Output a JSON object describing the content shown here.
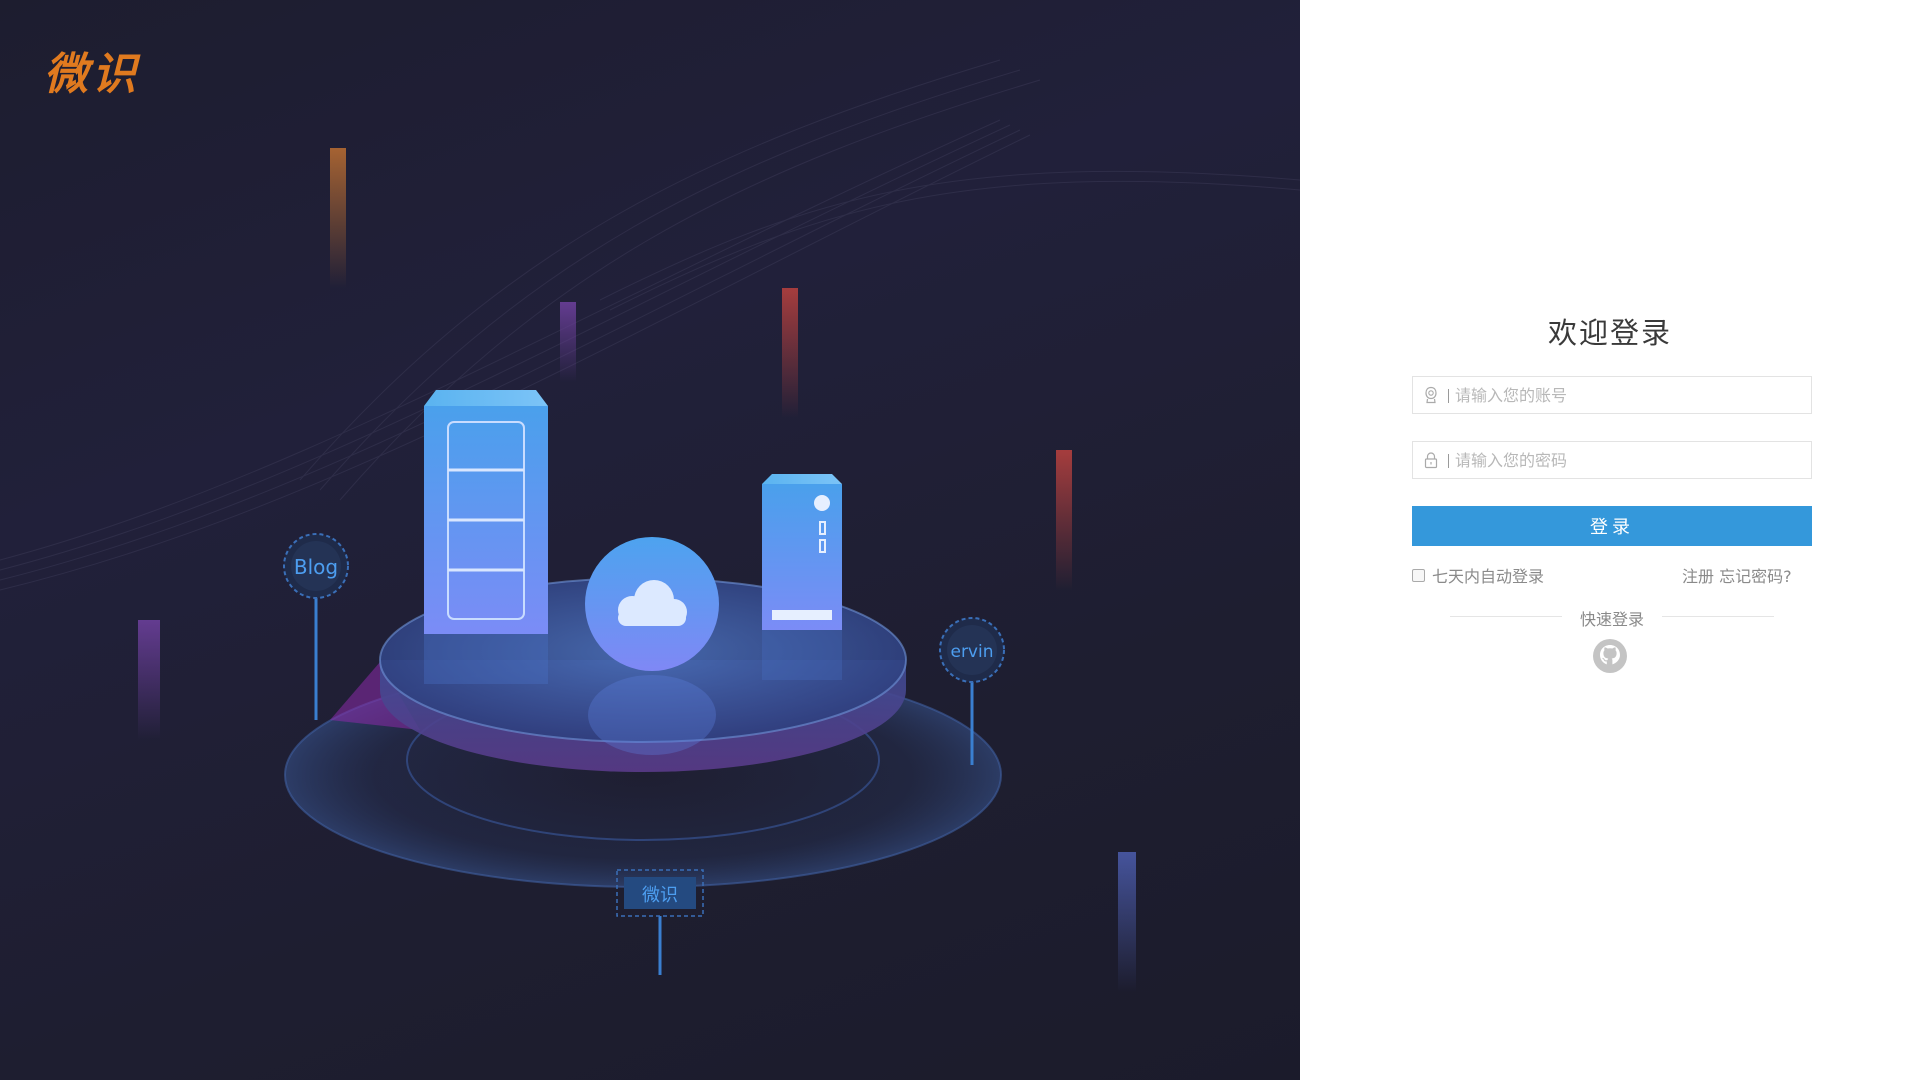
{
  "brand": {
    "logo_text": "微识"
  },
  "illustration": {
    "bubble_left": "Blog",
    "bubble_right": "ervin",
    "sign_bottom": "微识"
  },
  "login": {
    "title": "欢迎登录",
    "username_placeholder": "请输入您的账号",
    "password_placeholder": "请输入您的密码",
    "submit_label": "登录",
    "remember_label": "七天内自动登录",
    "register_link": "注册",
    "forgot_link": "忘记密码?",
    "quick_login_label": "快速登录"
  },
  "colors": {
    "left_background": "#1e1e30",
    "accent": "#3498db",
    "logo": "#e07a1f"
  },
  "icons": [
    "user-icon",
    "lock-icon",
    "github-icon",
    "cloud-icon"
  ]
}
